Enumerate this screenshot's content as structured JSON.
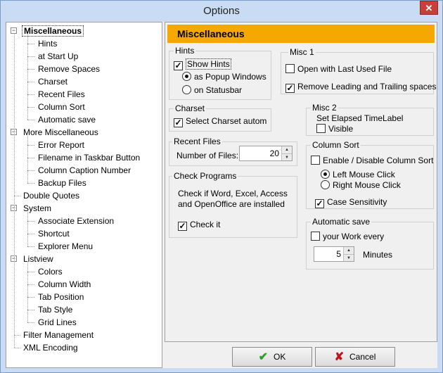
{
  "window": {
    "title": "Options",
    "close_glyph": "✕"
  },
  "tree": {
    "items": [
      {
        "label": "Miscellaneous",
        "level": 0,
        "expander": true
      },
      {
        "label": "Hints",
        "level": 1
      },
      {
        "label": "at Start Up",
        "level": 1
      },
      {
        "label": "Remove Spaces",
        "level": 1
      },
      {
        "label": "Charset",
        "level": 1
      },
      {
        "label": "Recent Files",
        "level": 1
      },
      {
        "label": "Column Sort",
        "level": 1
      },
      {
        "label": "Automatic save",
        "level": 1
      },
      {
        "label": "More Miscellaneous",
        "level": 0,
        "expander": true
      },
      {
        "label": "Error Report",
        "level": 1
      },
      {
        "label": "Filename in Taskbar Button",
        "level": 1
      },
      {
        "label": "Column Caption Number",
        "level": 1
      },
      {
        "label": "Backup Files",
        "level": 1
      },
      {
        "label": "Double Quotes",
        "level": 0
      },
      {
        "label": "System",
        "level": 0,
        "expander": true
      },
      {
        "label": "Associate Extension",
        "level": 1
      },
      {
        "label": "Shortcut",
        "level": 1
      },
      {
        "label": "Explorer Menu",
        "level": 1
      },
      {
        "label": "Listview",
        "level": 0,
        "expander": true
      },
      {
        "label": "Colors",
        "level": 1
      },
      {
        "label": "Column Width",
        "level": 1
      },
      {
        "label": "Tab Position",
        "level": 1
      },
      {
        "label": "Tab Style",
        "level": 1
      },
      {
        "label": "Grid Lines",
        "level": 1
      },
      {
        "label": "Filter Management",
        "level": 0
      },
      {
        "label": "XML Encoding",
        "level": 0
      }
    ],
    "expander_glyph": "−"
  },
  "panel": {
    "header": "Miscellaneous",
    "hints": {
      "title": "Hints",
      "show_hints": "Show Hints",
      "as_popup": "as Popup Windows",
      "on_statusbar": "on Statusbar"
    },
    "misc1": {
      "title": "Misc 1",
      "open_last": "Open with Last Used File",
      "remove_spaces": "Remove Leading and Trailing spaces"
    },
    "charset": {
      "title": "Charset",
      "select": "Select Charset autom"
    },
    "misc2": {
      "title": "Misc 2",
      "set_elapsed": "Set Elapsed TimeLabel",
      "visible": "Visible"
    },
    "recent_files": {
      "title": "Recent Files",
      "number_label": "Number of Files:",
      "number_value": "20"
    },
    "column_sort": {
      "title": "Column Sort",
      "enable": "Enable / Disable Column Sort",
      "left_click": "Left Mouse Click",
      "right_click": "Right Mouse Click",
      "case": "Case Sensitivity"
    },
    "check_programs": {
      "title": "Check Programs",
      "text1": "Check if Word, Excel, Access",
      "text2": "and OpenOffice are installed",
      "check_it": "Check it"
    },
    "auto_save": {
      "title": "Automatic save",
      "your_work": "your Work every",
      "minutes_value": "5",
      "minutes_label": "Minutes"
    }
  },
  "buttons": {
    "ok": "OK",
    "ok_glyph": "✔",
    "cancel": "Cancel",
    "cancel_glyph": "✘"
  },
  "glyphs": {
    "check": "✓",
    "up": "▲",
    "down": "▼"
  }
}
